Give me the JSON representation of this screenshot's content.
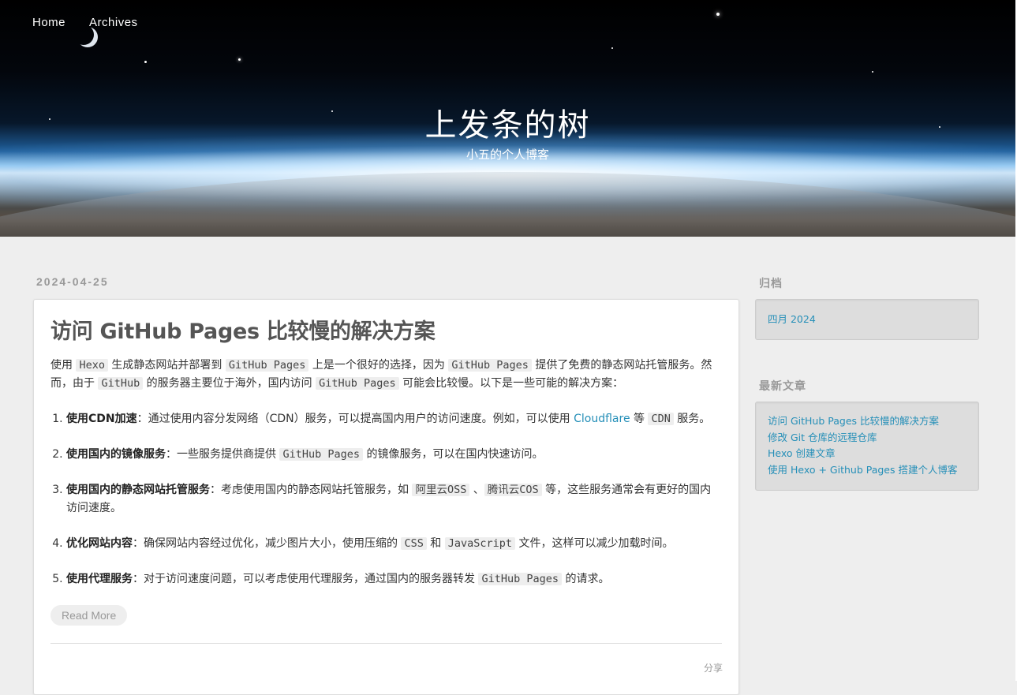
{
  "nav": {
    "items": [
      "Home",
      "Archives"
    ]
  },
  "header": {
    "title": "上发条的树",
    "subtitle": "小五的个人博客"
  },
  "post": {
    "date": "2024-04-25",
    "title": "访问 GitHub Pages 比较慢的解决方案",
    "intro": {
      "t1": "使用 ",
      "c1": "Hexo",
      "t2": " 生成静态网站并部署到 ",
      "c2": "GitHub Pages",
      "t3": " 上是一个很好的选择，因为 ",
      "c3": "GitHub Pages",
      "t4": " 提供了免费的静态网站托管服务。然而，由于 ",
      "c4": "GitHub",
      "t5": " 的服务器主要位于海外，国内访问 ",
      "c5": "GitHub Pages",
      "t6": " 可能会比较慢。以下是一些可能的解决方案："
    },
    "items": [
      {
        "bold": "使用CDN加速",
        "t1": "：通过使用内容分发网络（CDN）服务，可以提高国内用户的访问速度。例如，可以使用 ",
        "link": "Cloudflare",
        "t2": " 等 ",
        "c1": "CDN",
        "t3": " 服务。"
      },
      {
        "bold": "使用国内的镜像服务",
        "t1": "：一些服务提供商提供 ",
        "c1": "GitHub Pages",
        "t2": " 的镜像服务，可以在国内快速访问。"
      },
      {
        "bold": "使用国内的静态网站托管服务",
        "t1": "：考虑使用国内的静态网站托管服务，如 ",
        "c1": "阿里云OSS",
        "t2": " 、",
        "c2": "腾讯云COS",
        "t3": " 等，这些服务通常会有更好的国内访问速度。"
      },
      {
        "bold": "优化网站内容",
        "t1": "：确保网站内容经过优化，减少图片大小，使用压缩的 ",
        "c1": "CSS",
        "t2": " 和 ",
        "c2": "JavaScript",
        "t3": " 文件，这样可以减少加载时间。"
      },
      {
        "bold": "使用代理服务",
        "t1": "：对于访问速度问题，可以考虑使用代理服务，通过国内的服务器转发 ",
        "c1": "GitHub Pages",
        "t2": " 的请求。"
      }
    ],
    "read_more": "Read More",
    "share": "分享"
  },
  "sidebar": {
    "archive_title": "归档",
    "archives": [
      "四月 2024"
    ],
    "recent_title": "最新文章",
    "recent": [
      "访问 GitHub Pages 比较慢的解决方案",
      "修改 Git 仓库的远程仓库",
      "Hexo 创建文章",
      "使用 Hexo + Github Pages 搭建个人博客"
    ]
  },
  "colors": {
    "link": "#258fb8",
    "background": "#eeeeee"
  }
}
